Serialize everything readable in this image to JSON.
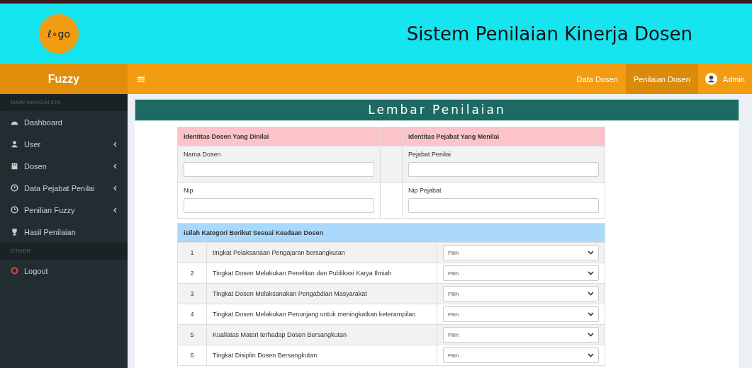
{
  "header": {
    "logo": "ℓ∘go",
    "title": "Sistem Penilaian Kinerja Dosen"
  },
  "navbar": {
    "brand": "Fuzzy",
    "menu_icon": "≡",
    "links": [
      {
        "label": "Data Dosen",
        "selected": false
      },
      {
        "label": "Penilaian Dosen",
        "selected": true
      }
    ],
    "user": "Admin"
  },
  "sidebar": {
    "sections": [
      {
        "heading": "MAIN NAVIGATION",
        "items": [
          {
            "label": "Dashboard",
            "expandable": false
          },
          {
            "label": "User",
            "expandable": true
          },
          {
            "label": "Dosen",
            "expandable": true
          },
          {
            "label": "Data Pejabat Penilai",
            "expandable": true
          },
          {
            "label": "Penilian Fuzzy",
            "expandable": true
          },
          {
            "label": "Hasil Penilaian",
            "expandable": false
          }
        ]
      },
      {
        "heading": "OTHER",
        "items": [
          {
            "label": "Logout",
            "expandable": false
          }
        ]
      }
    ]
  },
  "page_title": "Lembar Penilaian",
  "identity": {
    "left_heading": "Identitas Dosen Yang Dinilai",
    "right_heading": "Identitas Pejabat Yang Menilai",
    "rows": [
      {
        "left_label": "Nama Dosen",
        "right_label": "Pejabat Penilai"
      },
      {
        "left_label": "Nip",
        "right_label": "Nip Pejabat"
      }
    ]
  },
  "criteria": {
    "heading": "isilah Kategori Berikut Sesuai Keadaan Dosen",
    "rows": [
      {
        "number": "1",
        "text": "tingkat Pelaksanaan Pengajaran bersangkutan",
        "choice": "Pilih"
      },
      {
        "number": "2",
        "text": "Tingkat Dosen Melakukan Penelitan dan Publikasi Karya Ilmiah",
        "choice": "Pilih"
      },
      {
        "number": "3",
        "text": "Tingkat Dosen Melaksanakan Pengabdian Masyarakat",
        "choice": "Pilih"
      },
      {
        "number": "4",
        "text": "Tingkat Dosen Melakukan Penunjang untuk meningkatkan keterampilan",
        "choice": "Pilih"
      },
      {
        "number": "5",
        "text": "Kualiatas Materi terhadap Dosen Bersangkutan",
        "choice": "Pilih"
      },
      {
        "number": "6",
        "text": "Tingkat Disiplin Dosen Bersangkutan",
        "choice": "Pilih"
      }
    ]
  }
}
